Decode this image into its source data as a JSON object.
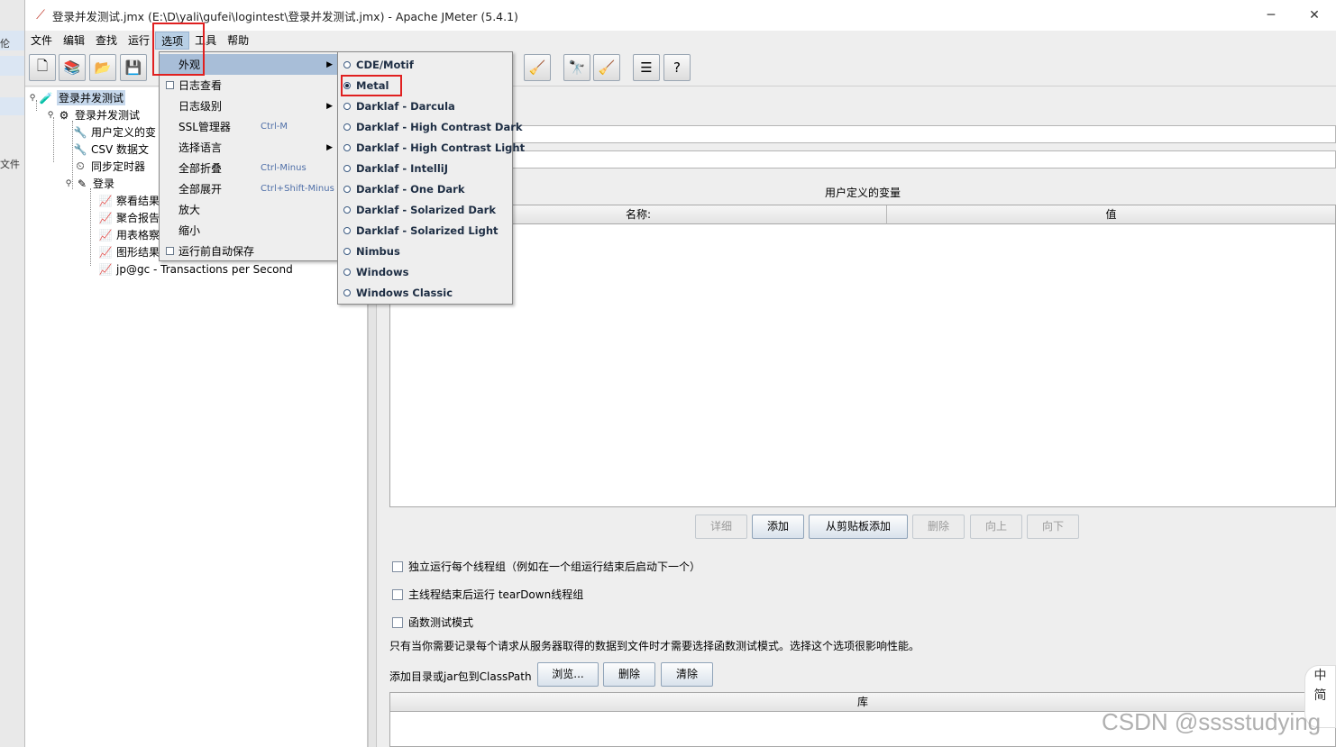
{
  "window": {
    "title": "登录并发测试.jmx (E:\\D\\yali\\gufei\\logintest\\登录并发测试.jmx) - Apache JMeter (5.4.1)",
    "minimize": "─",
    "close": "✕"
  },
  "desktop": {
    "item1": "伦",
    "item2": "文件"
  },
  "menubar": [
    "文件",
    "编辑",
    "查找",
    "运行",
    "选项",
    "工具",
    "帮助"
  ],
  "options_menu": [
    {
      "label": "外观",
      "submenu": true,
      "highlighted": true
    },
    {
      "label": "日志查看",
      "checkbox": true
    },
    {
      "label": "日志级别",
      "submenu": true
    },
    {
      "label": "SSL管理器",
      "shortcut": "Ctrl-M"
    },
    {
      "label": "选择语言",
      "submenu": true
    },
    {
      "label": "全部折叠",
      "shortcut": "Ctrl-Minus"
    },
    {
      "label": "全部展开",
      "shortcut": "Ctrl+Shift-Minus"
    },
    {
      "label": "放大"
    },
    {
      "label": "缩小"
    },
    {
      "label": "运行前自动保存",
      "checkbox": true
    }
  ],
  "lookandfeel_menu": [
    {
      "label": "CDE/Motif",
      "selected": false
    },
    {
      "label": "Metal",
      "selected": true
    },
    {
      "label": "Darklaf - Darcula",
      "selected": false
    },
    {
      "label": "Darklaf - High Contrast Dark",
      "selected": false
    },
    {
      "label": "Darklaf - High Contrast Light",
      "selected": false
    },
    {
      "label": "Darklaf - IntelliJ",
      "selected": false
    },
    {
      "label": "Darklaf - One Dark",
      "selected": false
    },
    {
      "label": "Darklaf - Solarized Dark",
      "selected": false
    },
    {
      "label": "Darklaf - Solarized Light",
      "selected": false
    },
    {
      "label": "Nimbus",
      "selected": false
    },
    {
      "label": "Windows",
      "selected": false
    },
    {
      "label": "Windows Classic",
      "selected": false
    }
  ],
  "tree": [
    {
      "label": "登录并发测试",
      "icon": "test-plan-icon",
      "selected": true
    },
    {
      "label": "登录并发测试",
      "icon": "thread-group-icon"
    },
    {
      "label": "用户定义的变",
      "icon": "config-wrench-icon"
    },
    {
      "label": "CSV 数据文",
      "icon": "config-wrench-icon"
    },
    {
      "label": "同步定时器",
      "icon": "timer-icon"
    },
    {
      "label": "登录",
      "icon": "sampler-pen-icon"
    },
    {
      "label": "察看结果",
      "icon": "listener-chart-icon"
    },
    {
      "label": "聚合报告",
      "icon": "listener-chart-icon"
    },
    {
      "label": "用表格察",
      "icon": "listener-chart-icon"
    },
    {
      "label": "图形结果",
      "icon": "listener-chart-icon"
    },
    {
      "label": "jp@gc - Transactions per Second",
      "icon": "listener-chart-icon"
    }
  ],
  "testplan": {
    "user_vars_title": "用户定义的变量",
    "col_name": "名称:",
    "col_value": "值",
    "buttons": {
      "detail": "详细",
      "add": "添加",
      "add_from_clipboard": "从剪贴板添加",
      "delete": "删除",
      "up": "向上",
      "down": "向下"
    },
    "checkbox_serialize": "独立运行每个线程组（例如在一个组运行结束后启动下一个）",
    "checkbox_teardown": "主线程结束后运行 tearDown线程组",
    "checkbox_functional": "函数测试模式",
    "functional_note": "只有当你需要记录每个请求从服务器取得的数据到文件时才需要选择函数测试模式。选择这个选项很影响性能。",
    "classpath_label": "添加目录或jar包到ClassPath",
    "browse": "浏览...",
    "cp_delete": "删除",
    "cp_clear": "清除",
    "lib_header": "库"
  },
  "ime": {
    "line1": "中",
    "line2": "简"
  },
  "watermark": "CSDN @sssstudying"
}
